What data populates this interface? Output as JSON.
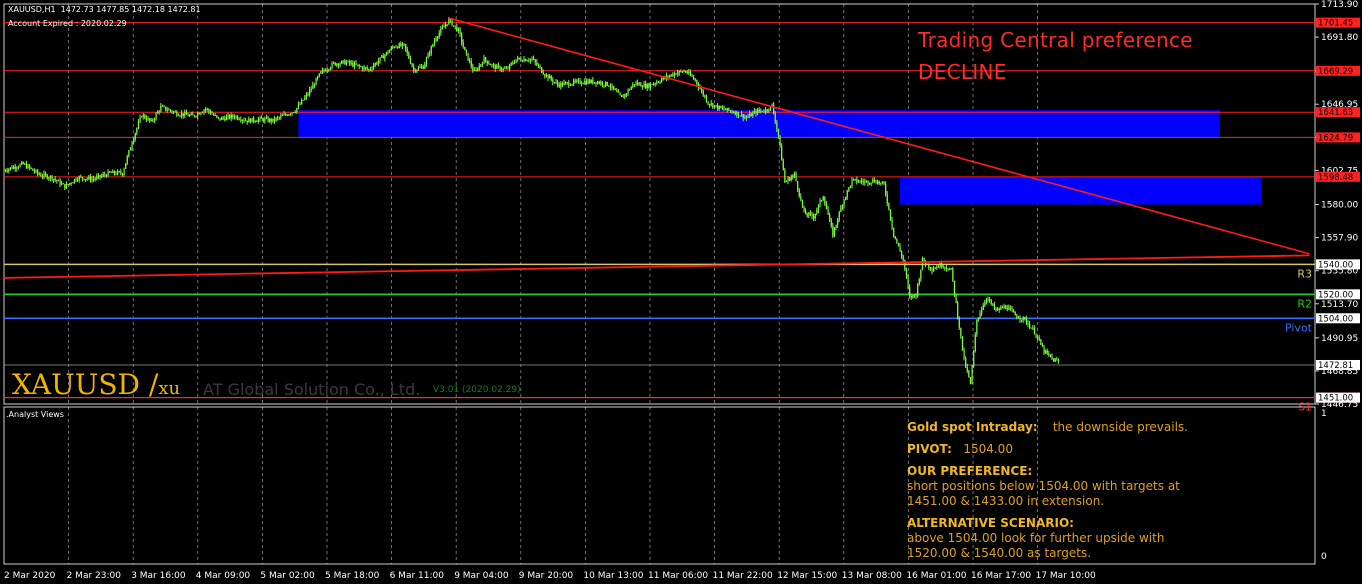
{
  "header": {
    "symbol_line": "XAUUSD,H1  1472.73 1477.85 1472.18 1472.81",
    "account_line": "Account Expired : 2020.02.29"
  },
  "preference": {
    "line1": "Trading Central preference",
    "line2": "DECLINE"
  },
  "watermark": {
    "symbol": "XAUUSD",
    "slash": " /",
    "tf": "xu",
    "company": "AT Global Solution Co., Ltd.",
    "version": "V3.01 (2020.02.29)"
  },
  "subwindow": {
    "label": ".Analyst Views",
    "scale_top": "1",
    "scale_bottom": "0"
  },
  "analysis": {
    "title": "Gold spot Intraday:",
    "title_text": "the downside prevails.",
    "pivot_label": "PIVOT:",
    "pivot_value": "1504.00",
    "pref_title": "OUR PREFERENCE:",
    "pref_text": "short positions below 1504.00 with targets at 1451.00 & 1433.00 in extension.",
    "alt_title": "ALTERNATIVE SCENARIO:",
    "alt_text": "above 1504.00 look for further upside with 1520.00 & 1540.00 as targets."
  },
  "colors": {
    "bg": "#000000",
    "candle": "#7cff3c",
    "level": "#ff2020",
    "zone": "#0000ff",
    "trend": "#ff1a1a",
    "r3": "#d6c46e",
    "r2": "#22cc22",
    "pivot": "#3a6bff",
    "s1": "#ff3030",
    "grid": "#ffffff"
  },
  "chart_data": {
    "type": "candlestick",
    "symbol": "XAUUSD",
    "timeframe": "H1",
    "ylim": [
      1446.75,
      1713.9
    ],
    "y_ticks": [
      "1713.90",
      "1691.80",
      "1669.29",
      "1646.95",
      "1624.79",
      "1602.75",
      "1580.00",
      "1557.90",
      "1535.80",
      "1513.70",
      "1490.95",
      "1468.85",
      "1446.75"
    ],
    "x_ticks": [
      "2 Mar 2020",
      "2 Mar 23:00",
      "3 Mar 16:00",
      "4 Mar 09:00",
      "5 Mar 02:00",
      "5 Mar 18:00",
      "6 Mar 11:00",
      "9 Mar 04:00",
      "9 Mar 20:00",
      "10 Mar 13:00",
      "11 Mar 06:00",
      "11 Mar 22:00",
      "12 Mar 15:00",
      "13 Mar 08:00",
      "16 Mar 01:00",
      "16 Mar 17:00",
      "17 Mar 10:00"
    ],
    "current_price": 1472.81,
    "current_price_label": "1472.81",
    "levels": [
      {
        "value": 1701.45,
        "label": "1701.45",
        "color": "#ff2020"
      },
      {
        "value": 1669.29,
        "label": "1669.29",
        "color": "#ff2020"
      },
      {
        "value": 1641.63,
        "label": "1641.63",
        "color": "#ff2020"
      },
      {
        "value": 1624.79,
        "label": "1624.79",
        "color": "#ff2020"
      },
      {
        "value": 1598.48,
        "label": "1598.48",
        "color": "#ff2020"
      },
      {
        "value": 1451.0,
        "label": "1451.00",
        "color": "#ff2020"
      }
    ],
    "pivots": [
      {
        "name": "R3",
        "value": 1540.0,
        "label": "1540.00",
        "color": "#d6c46e"
      },
      {
        "name": "R2",
        "value": 1520.0,
        "label": "1520.00",
        "color": "#22cc22"
      },
      {
        "name": "Pivot",
        "value": 1504.0,
        "label": "1504.00",
        "color": "#3a6bff"
      },
      {
        "name": "S1",
        "value": 1451.0,
        "label": "1451.00",
        "color": "#ff3030"
      }
    ],
    "zones": [
      {
        "from_index": 184,
        "to_index": 760,
        "low": 1624.79,
        "high": 1643.0
      },
      {
        "from_index": 560,
        "to_index": 786,
        "low": 1580.0,
        "high": 1598.5
      }
    ],
    "trendlines": [
      {
        "from_index": 278,
        "from_value": 1704.5,
        "to_index": 816,
        "to_value": 1547.0
      },
      {
        "from_index": 0,
        "from_value": 1531.0,
        "to_index": 816,
        "to_value": 1546.0
      }
    ],
    "close_path": [
      [
        0,
        1603
      ],
      [
        12,
        1607
      ],
      [
        22,
        1600
      ],
      [
        30,
        1598
      ],
      [
        38,
        1592
      ],
      [
        46,
        1598
      ],
      [
        56,
        1597
      ],
      [
        66,
        1601
      ],
      [
        74,
        1601
      ],
      [
        80,
        1622
      ],
      [
        86,
        1640
      ],
      [
        92,
        1635
      ],
      [
        98,
        1645
      ],
      [
        108,
        1641
      ],
      [
        118,
        1639
      ],
      [
        126,
        1644
      ],
      [
        134,
        1637
      ],
      [
        144,
        1639
      ],
      [
        152,
        1636
      ],
      [
        160,
        1637
      ],
      [
        168,
        1636
      ],
      [
        176,
        1640
      ],
      [
        182,
        1643
      ],
      [
        190,
        1654
      ],
      [
        198,
        1668
      ],
      [
        206,
        1674
      ],
      [
        214,
        1675
      ],
      [
        222,
        1672
      ],
      [
        228,
        1670
      ],
      [
        236,
        1678
      ],
      [
        244,
        1686
      ],
      [
        250,
        1686
      ],
      [
        256,
        1670
      ],
      [
        262,
        1672
      ],
      [
        270,
        1692
      ],
      [
        278,
        1703
      ],
      [
        284,
        1696
      ],
      [
        288,
        1682
      ],
      [
        294,
        1668
      ],
      [
        300,
        1677
      ],
      [
        306,
        1672
      ],
      [
        314,
        1670
      ],
      [
        320,
        1677
      ],
      [
        330,
        1677
      ],
      [
        338,
        1667
      ],
      [
        346,
        1660
      ],
      [
        354,
        1661
      ],
      [
        362,
        1662
      ],
      [
        370,
        1662
      ],
      [
        378,
        1660
      ],
      [
        386,
        1651
      ],
      [
        394,
        1661
      ],
      [
        402,
        1659
      ],
      [
        412,
        1664
      ],
      [
        420,
        1668
      ],
      [
        426,
        1669
      ],
      [
        432,
        1663
      ],
      [
        440,
        1648
      ],
      [
        448,
        1644
      ],
      [
        456,
        1642
      ],
      [
        464,
        1638
      ],
      [
        470,
        1642
      ],
      [
        476,
        1643
      ],
      [
        480,
        1646
      ],
      [
        484,
        1626
      ],
      [
        488,
        1595
      ],
      [
        494,
        1600
      ],
      [
        500,
        1574
      ],
      [
        506,
        1572
      ],
      [
        512,
        1586
      ],
      [
        518,
        1560
      ],
      [
        524,
        1581
      ],
      [
        530,
        1596
      ],
      [
        538,
        1595
      ],
      [
        544,
        1596
      ],
      [
        550,
        1593
      ],
      [
        556,
        1560
      ],
      [
        562,
        1543
      ],
      [
        566,
        1518
      ],
      [
        570,
        1520
      ],
      [
        574,
        1543
      ],
      [
        580,
        1537
      ],
      [
        586,
        1540
      ],
      [
        592,
        1536
      ],
      [
        596,
        1506
      ],
      [
        600,
        1476
      ],
      [
        604,
        1460
      ],
      [
        608,
        1503
      ],
      [
        614,
        1518
      ],
      [
        620,
        1509
      ],
      [
        626,
        1512
      ],
      [
        632,
        1506
      ],
      [
        638,
        1503
      ],
      [
        644,
        1495
      ],
      [
        650,
        1482
      ],
      [
        656,
        1476
      ],
      [
        660,
        1475
      ]
    ]
  }
}
